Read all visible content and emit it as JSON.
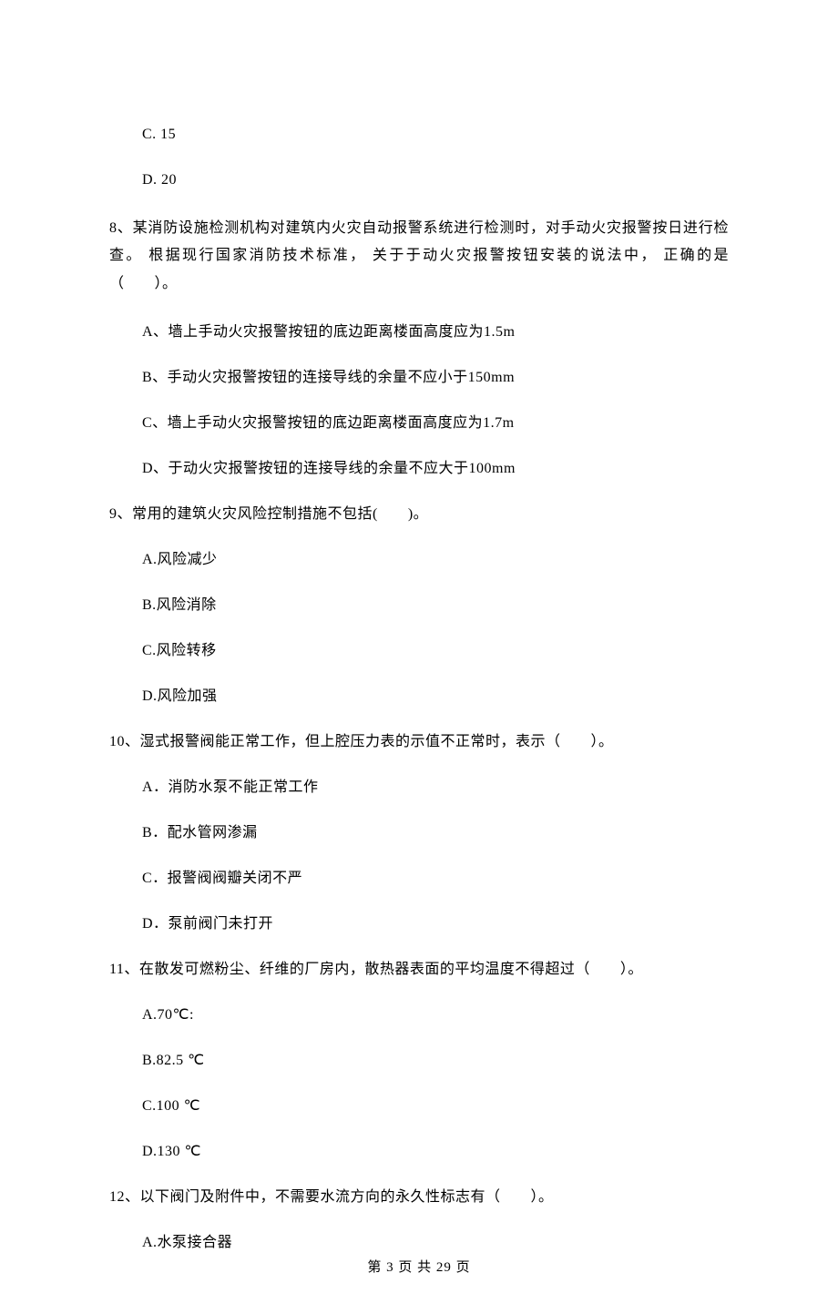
{
  "options_top": {
    "c": "C. 15",
    "d": "D. 20"
  },
  "q8": {
    "stem": "8、某消防设施检测机构对建筑内火灾自动报警系统进行检测时，对手动火灾报警按日进行检查。 根据现行国家消防技术标准， 关于于动火灾报警按钮安装的说法中， 正确的是（　　）。",
    "a": "A、墙上手动火灾报警按钮的底边距离楼面高度应为1.5m",
    "b": "B、手动火灾报警按钮的连接导线的余量不应小于150mm",
    "c": "C、墙上手动火灾报警按钮的底边距离楼面高度应为1.7m",
    "d": "D、于动火灾报警按钮的连接导线的余量不应大于100mm"
  },
  "q9": {
    "stem": "9、常用的建筑火灾风险控制措施不包括(　　)。",
    "a": "A.风险减少",
    "b": "B.风险消除",
    "c": "C.风险转移",
    "d": "D.风险加强"
  },
  "q10": {
    "stem": "10、湿式报警阀能正常工作，但上腔压力表的示值不正常时，表示（　　）。",
    "a": "A．消防水泵不能正常工作",
    "b": "B．配水管网渗漏",
    "c": "C．报警阀阀瓣关闭不严",
    "d": "D．泵前阀门未打开"
  },
  "q11": {
    "stem": "11、在散发可燃粉尘、纤维的厂房内，散热器表面的平均温度不得超过（　　）。",
    "a": "A.70℃:",
    "b": "B.82.5 ℃",
    "c": "C.100 ℃",
    "d": "D.130 ℃"
  },
  "q12": {
    "stem": "12、以下阀门及附件中，不需要水流方向的永久性标志有（　　）。",
    "a": "A.水泵接合器"
  },
  "footer": "第 3 页 共 29 页"
}
